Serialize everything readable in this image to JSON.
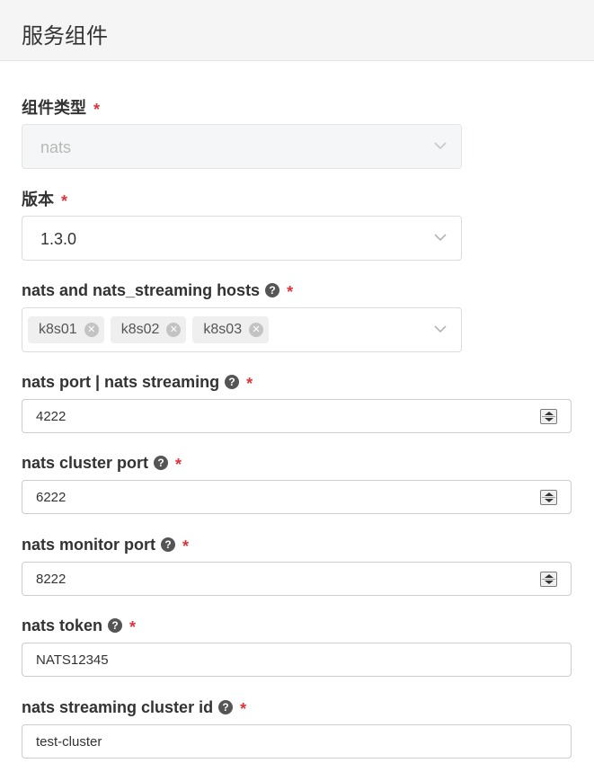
{
  "header": {
    "title": "服务组件"
  },
  "fields": {
    "component_type": {
      "label": "组件类型",
      "required_mark": "*",
      "value": "nats"
    },
    "version": {
      "label": "版本",
      "required_mark": "*",
      "value": "1.3.0"
    },
    "hosts": {
      "label": "nats and nats_streaming hosts",
      "help": "?",
      "required_mark": "*",
      "tags": [
        {
          "label": "k8s01"
        },
        {
          "label": "k8s02"
        },
        {
          "label": "k8s03"
        }
      ]
    },
    "nats_port": {
      "label": "nats port | nats streaming",
      "help": "?",
      "required_mark": "*",
      "value": "4222"
    },
    "cluster_port": {
      "label": "nats cluster port",
      "help": "?",
      "required_mark": "*",
      "value": "6222"
    },
    "monitor_port": {
      "label": "nats monitor port",
      "help": "?",
      "required_mark": "*",
      "value": "8222"
    },
    "token": {
      "label": "nats token",
      "help": "?",
      "required_mark": "*",
      "value": "NATS12345"
    },
    "cluster_id": {
      "label": "nats streaming cluster id",
      "help": "?",
      "required_mark": "*",
      "value": "test-cluster"
    }
  },
  "icons": {
    "chevron": "chevron-down-icon",
    "help": "question-circle-icon",
    "tag_close": "close-circle-icon",
    "spinner": "number-spinner-icon"
  },
  "colors": {
    "required": "#d9363e",
    "header_bg": "#f5f5f5",
    "tag_bg": "#efefef",
    "help_icon": "#555555"
  }
}
